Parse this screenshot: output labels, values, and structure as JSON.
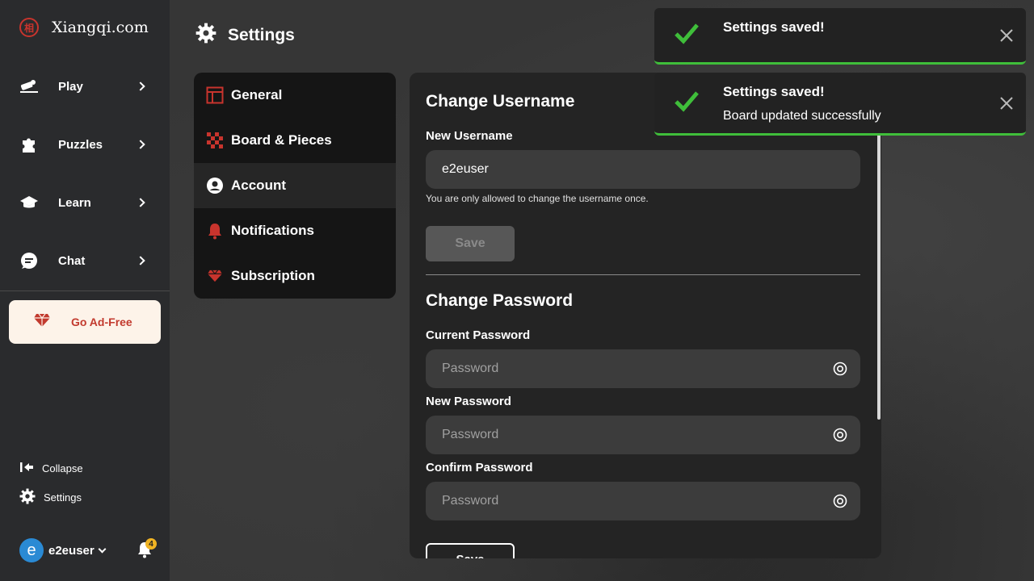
{
  "brand": {
    "name": "Xiangqi.com",
    "mark": "相"
  },
  "sidebar": {
    "items": [
      {
        "label": "Play",
        "icon": "play-hand-icon"
      },
      {
        "label": "Puzzles",
        "icon": "puzzle-icon"
      },
      {
        "label": "Learn",
        "icon": "graduation-cap-icon"
      },
      {
        "label": "Chat",
        "icon": "chat-bubble-icon"
      }
    ],
    "ad_free_label": "Go Ad-Free",
    "collapse_label": "Collapse",
    "settings_label": "Settings",
    "username": "e2euser",
    "avatar_letter": "e",
    "notification_count": "4"
  },
  "header": {
    "title": "Settings"
  },
  "settings_menu": {
    "items": [
      {
        "label": "General",
        "icon": "layout-icon"
      },
      {
        "label": "Board & Pieces",
        "icon": "checkerboard-icon"
      },
      {
        "label": "Account",
        "icon": "user-circle-icon",
        "active": true
      },
      {
        "label": "Notifications",
        "icon": "bell-icon"
      },
      {
        "label": "Subscription",
        "icon": "diamond-icon"
      }
    ]
  },
  "username_section": {
    "title": "Change Username",
    "field_label": "New Username",
    "value": "e2euser",
    "hint": "You are only allowed to change the username once.",
    "save_label": "Save"
  },
  "password_section": {
    "title": "Change Password",
    "current_label": "Current Password",
    "new_label": "New Password",
    "confirm_label": "Confirm Password",
    "placeholder": "Password",
    "save_label": "Save"
  },
  "toasts": [
    {
      "title": "Settings saved!",
      "message": ""
    },
    {
      "title": "Settings saved!",
      "message": "Board updated successfully"
    }
  ],
  "colors": {
    "accent_red": "#c8342d",
    "success_green": "#3fbe3a",
    "badge_yellow": "#f0b323"
  }
}
